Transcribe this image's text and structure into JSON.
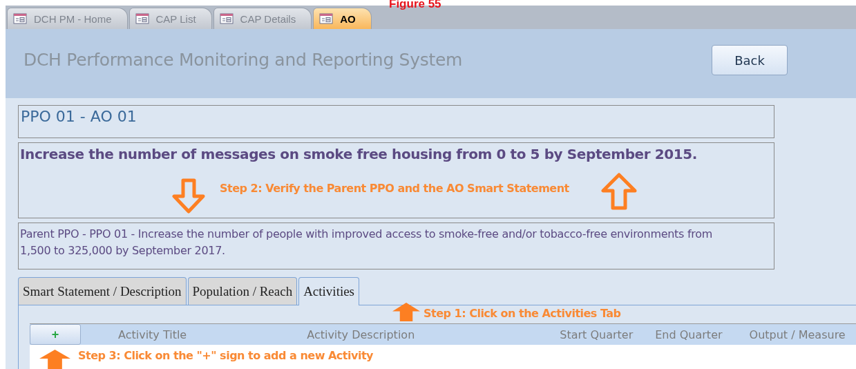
{
  "caption": "Figure 55",
  "document_tabs": [
    {
      "label": "DCH PM - Home",
      "selected": false
    },
    {
      "label": "CAP List",
      "selected": false
    },
    {
      "label": "CAP Details",
      "selected": false
    },
    {
      "label": "AO",
      "selected": true
    }
  ],
  "header": {
    "title": "DCH Performance Monitoring and Reporting System",
    "back_button": "Back"
  },
  "ao_code": "PPO 01 - AO 01",
  "smart_statement": "Increase the number of messages on smoke free housing  from 0 to 5 by September 2015.",
  "parent_ppo": "Parent PPO - PPO 01 - Increase the number of people with improved access to smoke-free and/or tobacco-free environments from 1,500 to 325,000 by September 2017.",
  "form_tabs": [
    {
      "label": "Smart Statement / Description",
      "selected": false
    },
    {
      "label": "Population / Reach",
      "selected": false
    },
    {
      "label": "Activities",
      "selected": true
    }
  ],
  "activities_grid": {
    "add_button": "+",
    "columns": [
      "Activity Title",
      "Activity Description",
      "Start Quarter",
      "End Quarter",
      "Output / Measure"
    ]
  },
  "annotations": [
    {
      "text": "Step 2: Verify the Parent PPO and the AO Smart Statement",
      "kind": "step2"
    },
    {
      "text": "Step 1: Click on the Activities Tab",
      "kind": "step1"
    },
    {
      "text": "Step 3: Click on the \"+\" sign to add a new Activity",
      "kind": "step3"
    }
  ]
}
